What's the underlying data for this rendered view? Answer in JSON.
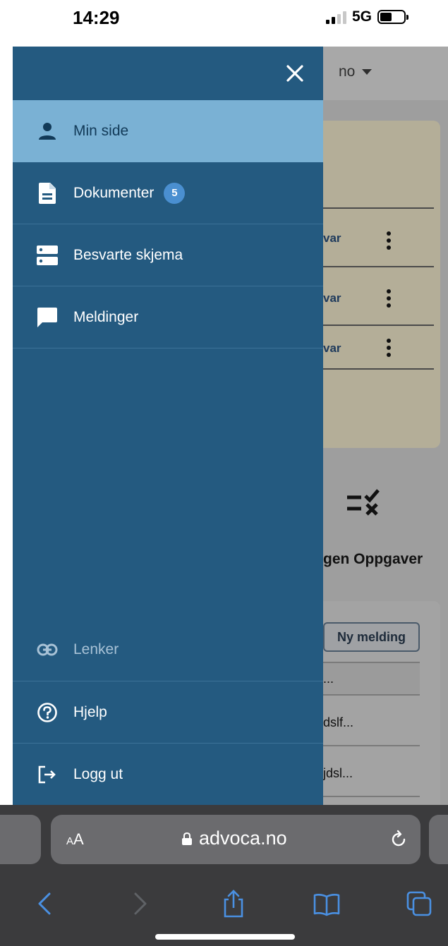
{
  "status_bar": {
    "time": "14:29",
    "network": "5G",
    "battery_level": 0.5
  },
  "page_behind": {
    "language": "no",
    "rows": [
      "var",
      "var",
      "var"
    ],
    "tasks_title": "gen Oppgaver",
    "new_message_label": "Ny melding",
    "messages": [
      "...",
      "dslf...",
      "jdsl..."
    ]
  },
  "drawer": {
    "close_icon": "close-icon",
    "items": [
      {
        "label": "Min side",
        "icon": "person-icon",
        "active": true
      },
      {
        "label": "Dokumenter",
        "icon": "document-icon",
        "badge": "5"
      },
      {
        "label": "Besvarte skjema",
        "icon": "forms-icon"
      },
      {
        "label": "Meldinger",
        "icon": "chat-icon"
      }
    ],
    "bottom_items": [
      {
        "label": "Lenker",
        "icon": "link-icon"
      },
      {
        "label": "Hjelp",
        "icon": "help-icon"
      },
      {
        "label": "Logg ut",
        "icon": "logout-icon"
      }
    ]
  },
  "browser": {
    "text_size_label_small": "A",
    "text_size_label_large": "A",
    "url": "advoca.no",
    "toolbar": [
      "back-icon",
      "forward-icon",
      "share-icon",
      "bookmarks-icon",
      "tabs-icon"
    ]
  },
  "colors": {
    "drawer": "#245a80",
    "active_item": "#7ab1d4",
    "badge": "#4a8fd0",
    "link_blue": "#1e3a5c",
    "safari_blue": "#4a90e2"
  }
}
